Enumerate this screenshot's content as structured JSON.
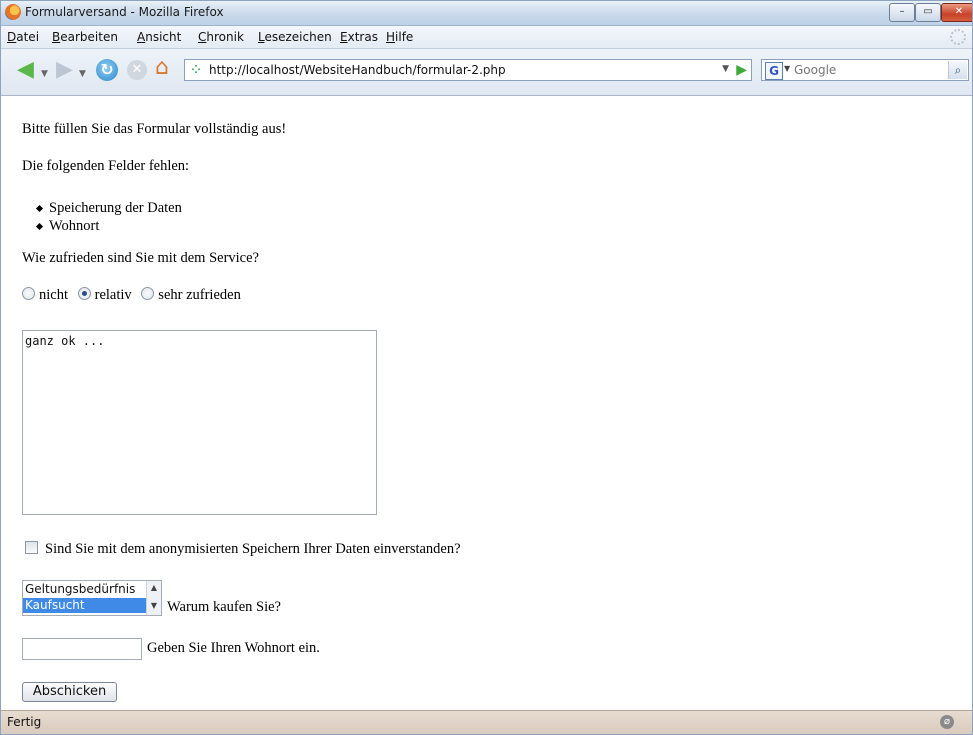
{
  "window": {
    "title": "Formularversand - Mozilla Firefox",
    "controls": {
      "minimize": "–",
      "maximize": "▭",
      "close": "✕"
    }
  },
  "menu": [
    "Datei",
    "Bearbeiten",
    "Ansicht",
    "Chronik",
    "Lesezeichen",
    "Extras",
    "Hilfe"
  ],
  "toolbar": {
    "url": "http://localhost/WebsiteHandbuch/formular-2.php",
    "search_engine_letter": "G",
    "search_placeholder": "Google",
    "icons": {
      "back": "back-icon",
      "forward": "forward-icon",
      "reload": "reload-icon",
      "stop": "stop-icon",
      "home": "home-icon",
      "go": "go-icon",
      "search": "search-icon"
    }
  },
  "content": {
    "intro": "Bitte füllen Sie das Formular vollständig aus!",
    "missing_heading": "Die folgenden Felder fehlen:",
    "missing_fields": [
      "Speicherung der Daten",
      "Wohnort"
    ],
    "question": "Wie zufrieden sind Sie mit dem Service?",
    "radio_options": [
      {
        "label": "nicht",
        "checked": false
      },
      {
        "label": "relativ",
        "checked": true
      },
      {
        "label": "sehr zufrieden",
        "checked": false
      }
    ],
    "comment_value": "ganz ok ...",
    "consent_label": "Sind Sie mit dem anonymisierten Speichern Ihrer Daten einverstanden?",
    "consent_checked": false,
    "list_options": [
      "Geltungsbedürfnis",
      "Kaufsucht"
    ],
    "list_selected": "Kaufsucht",
    "list_label": "Warum kaufen Sie?",
    "city_value": "",
    "city_label": "Geben Sie Ihren Wohnort ein.",
    "submit_label": "Abschicken"
  },
  "status": {
    "text": "Fertig"
  },
  "colors": {
    "selection": "#3f8ae6",
    "statusbar": "#d9cbbd",
    "titlebar": "#c9d9ea"
  }
}
